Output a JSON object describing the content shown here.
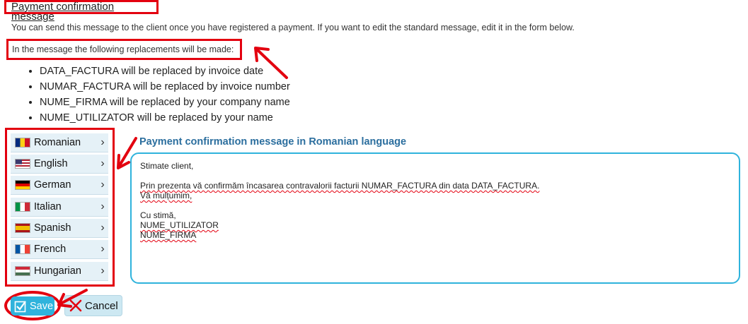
{
  "page": {
    "title": "Payment confirmation message",
    "intro": "You can send this message to the client once you have registered a payment. If you want to edit the standard message, edit it in the form below.",
    "replacements_title": "In the message the following replacements will be made:",
    "replacements": [
      "DATA_FACTURA will be replaced by invoice date",
      "NUMAR_FACTURA will be replaced by invoice number",
      "NUME_FIRMA will be replaced by your company name",
      "NUME_UTILIZATOR will be replaced by your name"
    ]
  },
  "languages": [
    {
      "label": "Romanian",
      "flag": "romania-flag-icon"
    },
    {
      "label": "English",
      "flag": "usa-flag-icon"
    },
    {
      "label": "German",
      "flag": "germany-flag-icon"
    },
    {
      "label": "Italian",
      "flag": "italy-flag-icon"
    },
    {
      "label": "Spanish",
      "flag": "spain-flag-icon"
    },
    {
      "label": "French",
      "flag": "france-flag-icon"
    },
    {
      "label": "Hungarian",
      "flag": "hungary-flag-icon"
    }
  ],
  "form": {
    "title": "Payment confirmation message in Romanian language",
    "message": {
      "greeting": "Stimate client,",
      "body_line1": "Prin prezenta vă confirmăm încasarea contravalorii facturii NUMAR_FACTURA din data DATA_FACTURA.",
      "body_line2": "Vă mulțumim,",
      "closing": "Cu stimă,",
      "user": "NUME_UTILIZATOR",
      "company": "NUME_FIRMA"
    }
  },
  "buttons": {
    "save_label": "Save",
    "cancel_label": "Cancel"
  },
  "colors": {
    "highlight": "#e3000f",
    "accent": "#2fb3dc",
    "form_title": "#2b6e9e",
    "language_item_bg": "#e5f1f7"
  }
}
